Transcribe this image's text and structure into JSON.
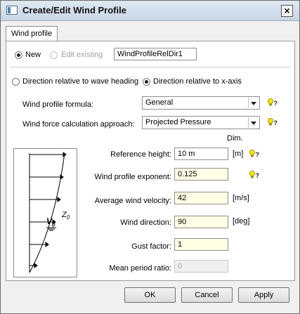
{
  "window": {
    "title": "Create/Edit Wind Profile"
  },
  "tabs": [
    {
      "label": "Wind profile"
    }
  ],
  "profile": {
    "new_label": "New",
    "edit_existing_label": "Edit existing",
    "name_value": "WindProfileRelDir1"
  },
  "direction": {
    "relative_wave_label": "Direction relative to wave heading",
    "relative_x_label": "Direction relative to x-axis"
  },
  "formula": {
    "label": "Wind profile formula:",
    "value": "General"
  },
  "approach": {
    "label": "Wind force calculation approach:",
    "value": "Projected Pressure"
  },
  "dim_header": "Dim.",
  "fields": {
    "reference_height": {
      "label": "Reference height:",
      "value": "10 m",
      "unit": "[m]"
    },
    "exponent": {
      "label": "Wind profile exponent:",
      "value": "0.125"
    },
    "velocity": {
      "label": "Average wind velocity:",
      "value": "42",
      "unit": "[m/s]"
    },
    "direction": {
      "label": "Wind direction:",
      "value": "90",
      "unit": "[deg]"
    },
    "gust": {
      "label": "Gust factor:",
      "value": "1"
    },
    "mean_period": {
      "label": "Mean period ratio:",
      "value": "0"
    }
  },
  "diagram": {
    "v_label": "V",
    "v_sub": "0",
    "z_label": "Z",
    "z_sub": "0"
  },
  "buttons": {
    "ok": "OK",
    "cancel": "Cancel",
    "apply": "Apply"
  },
  "icons": {
    "help": "lightbulb-help-icon"
  }
}
